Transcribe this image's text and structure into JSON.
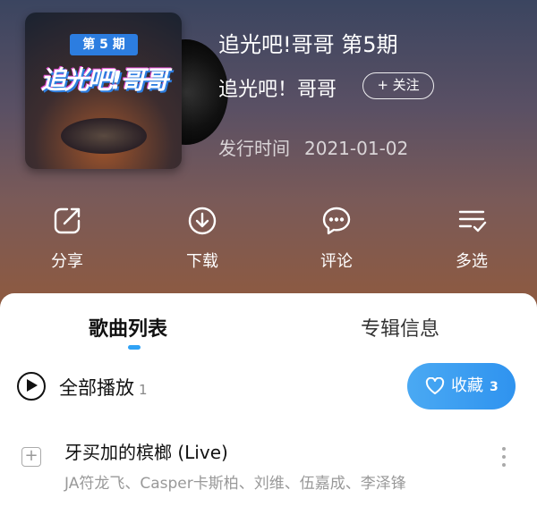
{
  "album": {
    "cover_badge": "第 5 期",
    "cover_title": "追光吧!哥哥",
    "title": "追光吧!哥哥 第5期",
    "artist": "追光吧！哥哥",
    "follow_label": "+ 关注",
    "release_label": "发行时间",
    "release_date": "2021-01-02"
  },
  "actions": [
    {
      "label": "分享",
      "icon": "share-icon"
    },
    {
      "label": "下载",
      "icon": "download-icon"
    },
    {
      "label": "评论",
      "icon": "comment-icon"
    },
    {
      "label": "多选",
      "icon": "multi-select-icon"
    }
  ],
  "tabs": [
    {
      "label": "歌曲列表",
      "active": true
    },
    {
      "label": "专辑信息",
      "active": false
    }
  ],
  "playall": {
    "label": "全部播放",
    "count": "1"
  },
  "collect": {
    "label": "收藏",
    "count": "3"
  },
  "songs": [
    {
      "title": "牙买加的槟榔 (Live)",
      "artists": "JA符龙飞、Casper卡斯柏、刘维、伍嘉成、李泽锋"
    }
  ],
  "colors": {
    "accent": "#2f93ef",
    "tab_indicator": "#2fa2f5"
  }
}
